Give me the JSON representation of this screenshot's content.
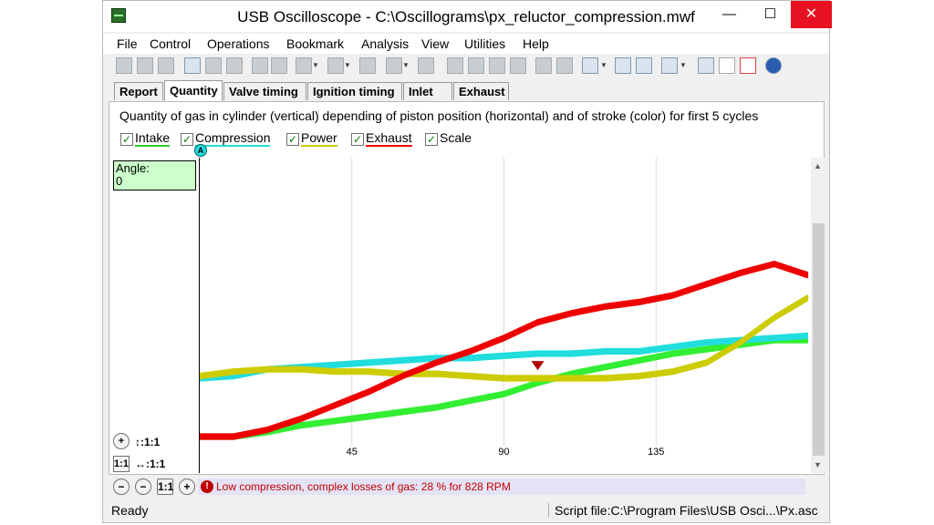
{
  "window": {
    "title": "USB Oscilloscope - C:\\Oscillograms\\px_reluctor_compression.mwf",
    "minimize": "—",
    "maximize": "☐",
    "close": "✕"
  },
  "menu": [
    "File",
    "Control",
    "Operations",
    "Bookmark",
    "Analysis",
    "View",
    "Utilities",
    "Help"
  ],
  "tabs": [
    {
      "label": "Report",
      "active": false
    },
    {
      "label": "Quantity",
      "active": true
    },
    {
      "label": "Valve timing",
      "active": false
    },
    {
      "label": "Ignition timing",
      "active": false
    },
    {
      "label": "Inlet",
      "active": false
    },
    {
      "label": "Exhaust",
      "active": false
    }
  ],
  "description": "Quantity of gas in cylinder (vertical) depending of piston position (horizontal) and of stroke (color) for first 5 cycles",
  "legend": [
    {
      "label": "Intake",
      "color": "#33cc33",
      "checked": true
    },
    {
      "label": "Compression",
      "color": "#22dddd",
      "checked": true
    },
    {
      "label": "Power",
      "color": "#cccc00",
      "checked": true
    },
    {
      "label": "Exhaust",
      "color": "#ee0000",
      "checked": true
    },
    {
      "label": "Scale",
      "checked": true
    }
  ],
  "check_mark": "✓",
  "marker_A": "A",
  "angle_box": {
    "label": "Angle:",
    "value": "0"
  },
  "scale": {
    "vertical_label": "↕:1:1",
    "horizontal_label": "↔:1:1",
    "plus": "+",
    "minus": "−",
    "one_to_one": "1:1"
  },
  "message": {
    "icon": "!",
    "text": "Low compression, complex losses of gas: 28 % for 828 RPM"
  },
  "status": {
    "left": "Ready",
    "right": "Script file:C:\\Program Files\\USB Osci...\\Px.asc"
  },
  "chart_data": {
    "type": "line",
    "x_ticks": [
      45,
      90,
      135
    ],
    "xlim": [
      0,
      180
    ],
    "grid": "vertical",
    "series": [
      {
        "name": "Intake",
        "color": "#33ee33",
        "x": [
          0,
          10,
          20,
          30,
          40,
          50,
          60,
          70,
          80,
          90,
          100,
          110,
          120,
          130,
          140,
          150,
          160,
          170,
          180
        ],
        "y": [
          0.0,
          0.0,
          0.02,
          0.05,
          0.07,
          0.09,
          0.11,
          0.13,
          0.16,
          0.19,
          0.24,
          0.28,
          0.31,
          0.34,
          0.37,
          0.39,
          0.41,
          0.43,
          0.43
        ]
      },
      {
        "name": "Compression",
        "color": "#22dddd",
        "x": [
          0,
          10,
          20,
          30,
          40,
          50,
          60,
          70,
          80,
          90,
          100,
          110,
          120,
          130,
          140,
          150,
          160,
          170,
          180
        ],
        "y": [
          0.26,
          0.27,
          0.3,
          0.31,
          0.32,
          0.33,
          0.34,
          0.35,
          0.35,
          0.36,
          0.37,
          0.37,
          0.38,
          0.38,
          0.4,
          0.42,
          0.43,
          0.44,
          0.45
        ]
      },
      {
        "name": "Power",
        "color": "#cccc00",
        "x": [
          0,
          10,
          20,
          30,
          40,
          50,
          60,
          70,
          80,
          90,
          100,
          110,
          120,
          130,
          140,
          150,
          160,
          170,
          180
        ],
        "y": [
          0.27,
          0.29,
          0.3,
          0.3,
          0.29,
          0.29,
          0.28,
          0.28,
          0.27,
          0.26,
          0.26,
          0.26,
          0.26,
          0.27,
          0.29,
          0.33,
          0.42,
          0.53,
          0.62
        ]
      },
      {
        "name": "Exhaust",
        "color": "#ee0000",
        "x": [
          0,
          10,
          20,
          30,
          40,
          50,
          60,
          70,
          80,
          90,
          100,
          110,
          120,
          130,
          140,
          150,
          160,
          170,
          180
        ],
        "y": [
          0.0,
          0.0,
          0.03,
          0.08,
          0.14,
          0.2,
          0.27,
          0.33,
          0.38,
          0.44,
          0.51,
          0.55,
          0.58,
          0.6,
          0.63,
          0.68,
          0.73,
          0.77,
          0.72
        ]
      }
    ],
    "ylim": [
      0,
      1
    ]
  }
}
